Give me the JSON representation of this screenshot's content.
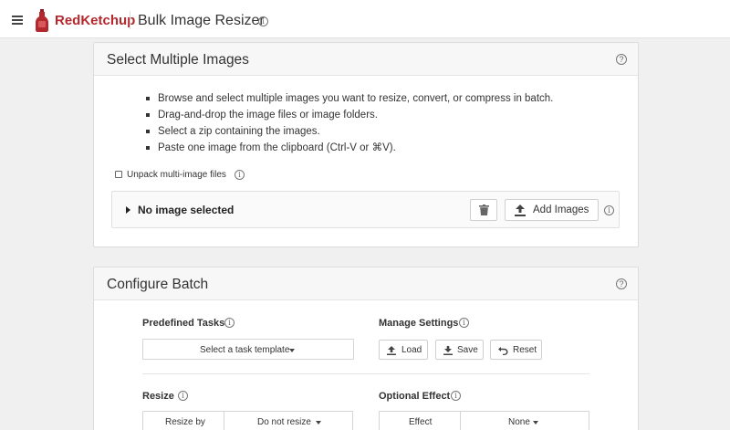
{
  "header": {
    "brand": "RedKetchup",
    "title": "Bulk Image Resizer",
    "menu_icon": "hamburger-icon",
    "brand_color": "#b3282d"
  },
  "select_panel": {
    "title": "Select Multiple Images",
    "instructions": [
      "Browse and select multiple images you want to resize, convert, or compress in batch.",
      "Drag-and-drop the image files or image folders.",
      "Select a zip containing the images.",
      "Paste one image from the clipboard (Ctrl-V or ⌘V)."
    ],
    "unpack_label": "Unpack multi-image files",
    "unpack_checked": false,
    "no_image_label": "No image selected",
    "add_images_label": "Add Images"
  },
  "configure_panel": {
    "title": "Configure Batch",
    "predefined_tasks_label": "Predefined Tasks",
    "task_template_placeholder": "Select a task template",
    "manage_settings_label": "Manage Settings",
    "load_label": "Load",
    "save_label": "Save",
    "reset_label": "Reset",
    "resize_label": "Resize",
    "resize_by_label": "Resize by",
    "resize_by_value": "Do not resize",
    "optional_effect_label": "Optional Effect",
    "effect_label": "Effect",
    "effect_value": "None"
  }
}
